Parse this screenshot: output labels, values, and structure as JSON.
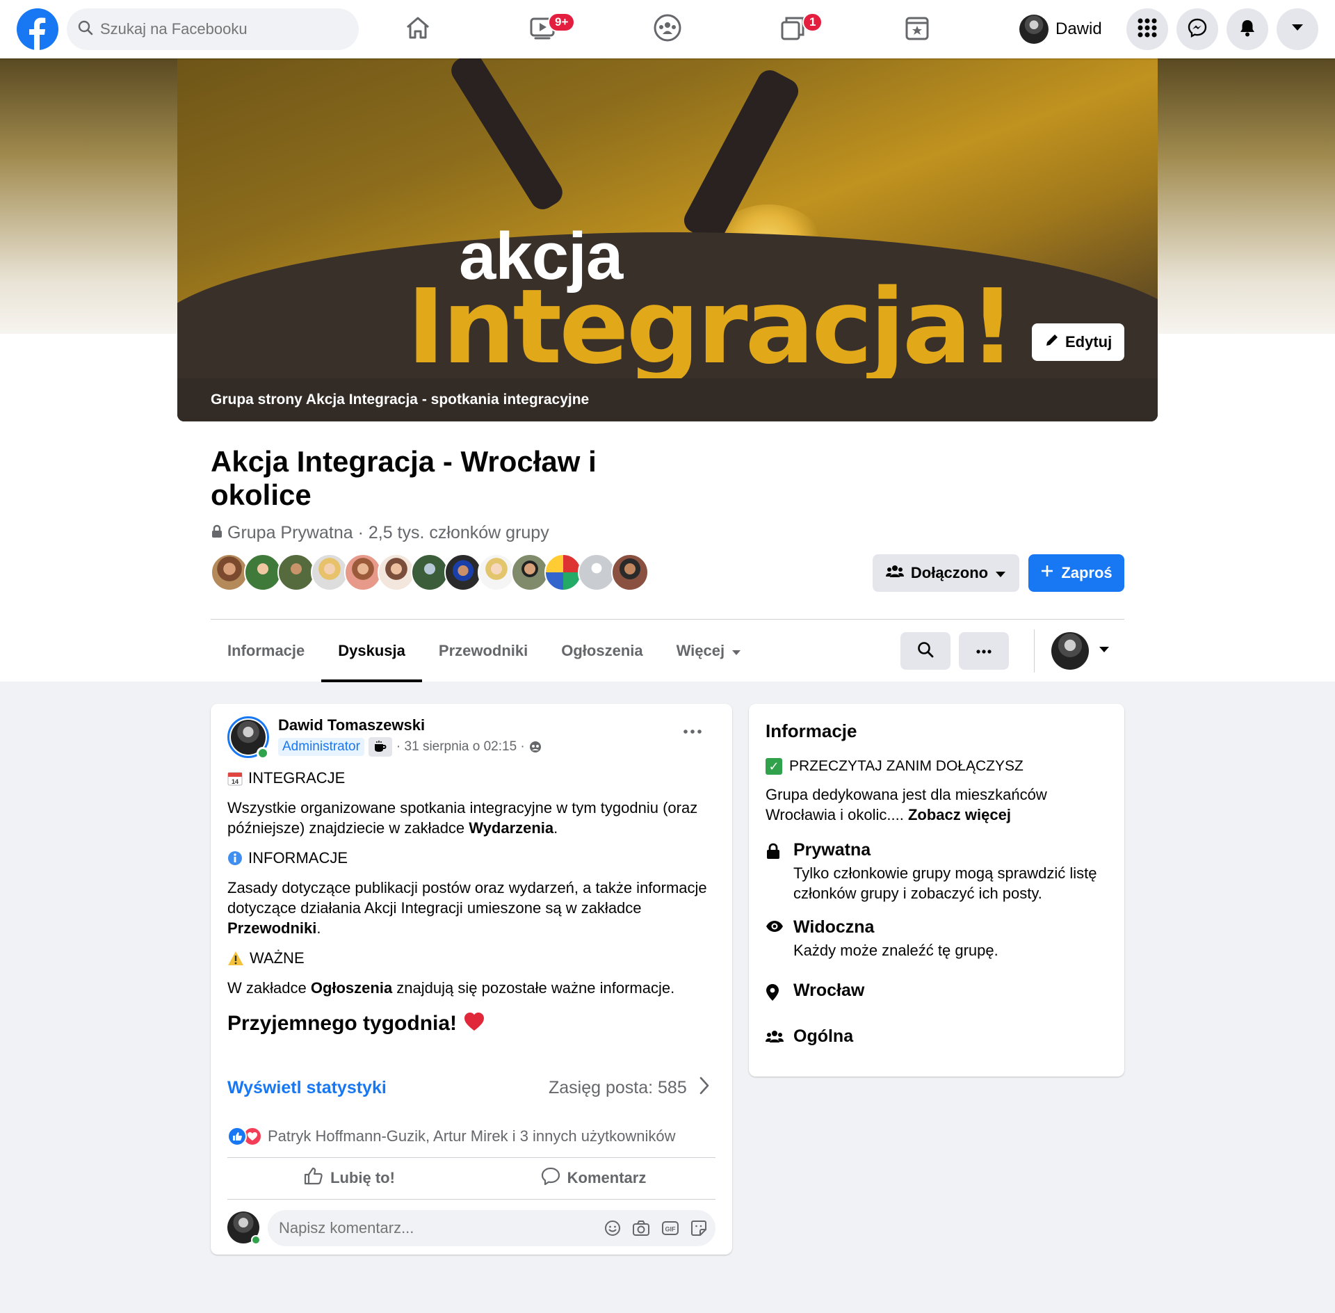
{
  "topnav": {
    "search_placeholder": "Szukaj na Facebooku",
    "video_badge": "9+",
    "groups_badge": "1",
    "profile_name": "Dawid"
  },
  "cover": {
    "text_line1": "akcja",
    "text_line2": "Integracja!",
    "edit_label": "Edytuj",
    "caption": "Grupa strony Akcja Integracja - spotkania integracyjne"
  },
  "group": {
    "title": "Akcja Integracja - Wrocław i okolice",
    "privacy": "Grupa Prywatna",
    "members_count": "2,5 tys. członków grupy",
    "joined_label": "Dołączono",
    "invite_label": "Zaproś"
  },
  "tabs": [
    {
      "label": "Informacje"
    },
    {
      "label": "Dyskusja"
    },
    {
      "label": "Przewodniki"
    },
    {
      "label": "Ogłoszenia"
    },
    {
      "label": "Więcej"
    }
  ],
  "post": {
    "author": "Dawid Tomaszewski",
    "role": "Administrator",
    "time": "· 31 sierpnia o 02:15 ·",
    "sec1_title": "INTEGRACJE",
    "sec1_text_a": "Wszystkie organizowane spotkania integracyjne w tym tygodniu (oraz późniejsze) znajdziecie w zakładce ",
    "sec1_text_b": "Wydarzenia",
    "sec1_text_c": ".",
    "sec2_title": "INFORMACJE",
    "sec2_text_a": "Zasady dotyczące publikacji postów oraz wydarzeń, a także informacje dotyczące działania Akcji Integracji umieszone są w zakładce ",
    "sec2_text_b": "Przewodniki",
    "sec2_text_c": ".",
    "sec3_title": "WAŻNE",
    "sec3_text_a": "W zakładce ",
    "sec3_text_b": "Ogłoszenia",
    "sec3_text_c": " znajdują się pozostałe ważne informacje.",
    "closing": "Przyjemnego tygodnia!",
    "stats_link": "Wyświetl statystyki",
    "reach": "Zasięg posta: 585",
    "reactions_text": "Patryk Hoffmann-Guzik, Artur Mirek i 3 innych użytkowników",
    "like_label": "Lubię to!",
    "comment_label": "Komentarz",
    "comment_placeholder": "Napisz komentarz..."
  },
  "info": {
    "heading": "Informacje",
    "rules_title": "PRZECZYTAJ ZANIM DOŁĄCZYSZ",
    "desc": "Grupa dedykowana jest dla mieszkańców Wrocławia i okolic.... ",
    "see_more": "Zobacz więcej",
    "private_title": "Prywatna",
    "private_desc": "Tylko członkowie grupy mogą sprawdzić listę członków grupy i zobaczyć ich posty.",
    "visible_title": "Widoczna",
    "visible_desc": "Każdy może znaleźć tę grupę.",
    "location": "Wrocław",
    "category": "Ogólna"
  },
  "colors": {
    "accent": "#1877f2",
    "cover_yellow": "#e1a81a",
    "online": "#31a24c",
    "badge": "#e41e3f"
  },
  "icons": [
    "facebook-logo",
    "search-icon",
    "home-icon",
    "watch-icon",
    "groups-icon",
    "gaming-icon",
    "marketplace-icon",
    "menu-grid-icon",
    "messenger-icon",
    "bell-icon",
    "caret-down-icon",
    "pencil-icon",
    "lock-icon",
    "people-icon",
    "plus-icon",
    "more-icon",
    "calendar-icon",
    "info-icon",
    "warning-icon",
    "heart-icon",
    "chevron-right-icon",
    "like-icon",
    "comment-icon",
    "emoji-icon",
    "camera-icon",
    "gif-icon",
    "sticker-icon",
    "check-icon",
    "eye-icon",
    "location-icon"
  ]
}
